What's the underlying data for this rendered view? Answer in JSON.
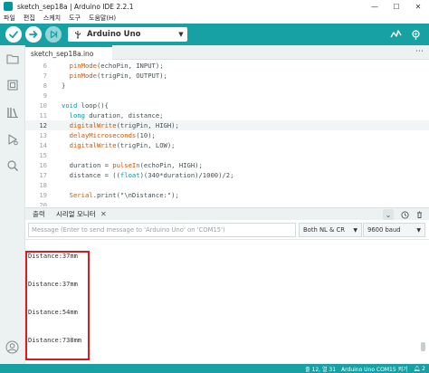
{
  "window": {
    "title": "sketch_sep18a | Arduino IDE 2.2.1",
    "controls": [
      "—",
      "☐",
      "✕"
    ]
  },
  "menu": [
    "파일",
    "편집",
    "스케치",
    "도구",
    "도움말(H)"
  ],
  "toolbar": {
    "board_name": "Arduino Uno",
    "board_arrow": "▼"
  },
  "tabs": [
    {
      "label": "sketch_sep18a.ino"
    }
  ],
  "tab_more": "⋯",
  "editor": {
    "active_line": "12",
    "lines": [
      {
        "n": "6",
        "pre": "  ",
        "kw": "pinMode",
        "post": "(echoPin, INPUT);"
      },
      {
        "n": "7",
        "pre": "  ",
        "kw": "pinMode",
        "post": "(trigPin, OUTPUT);"
      },
      {
        "n": "8",
        "pre": "",
        "kw": "",
        "post": "}"
      },
      {
        "n": "9",
        "pre": "",
        "kw": "",
        "post": ""
      },
      {
        "n": "10",
        "pre": "",
        "kw": "void",
        "post": " loop(){"
      },
      {
        "n": "11",
        "pre": "  ",
        "kw": "long",
        "post": " duration, distance;"
      },
      {
        "n": "12",
        "pre": "  ",
        "kw": "digitalWrite",
        "post": "(trigPin, HIGH);"
      },
      {
        "n": "13",
        "pre": "  ",
        "kw": "delayMicroseconds",
        "post": "(10);"
      },
      {
        "n": "14",
        "pre": "  ",
        "kw": "digitalWrite",
        "post": "(trigPin, LOW);"
      },
      {
        "n": "15",
        "pre": "",
        "kw": "",
        "post": ""
      },
      {
        "n": "16",
        "pre": "  duration = ",
        "kw": "pulseIn",
        "post": "(echoPin, HIGH);"
      },
      {
        "n": "17",
        "pre": "  distance = ((",
        "kw": "float",
        "post": ")(340*duration)/1000)/2;"
      },
      {
        "n": "18",
        "pre": "",
        "kw": "",
        "post": ""
      },
      {
        "n": "19",
        "pre": "  ",
        "kw": "Serial",
        "post": ".print(\"\\nDistance:\");"
      },
      {
        "n": "20",
        "pre": "",
        "kw": "",
        "post": ""
      }
    ]
  },
  "panel": {
    "tab_output": "출력",
    "tab_serial": "시리얼 모니터",
    "close": "✕",
    "chevron": "⌄"
  },
  "serial": {
    "placeholder": "Message (Enter to send message to 'Arduino Uno' on 'COM15')",
    "line_ending": "Both NL & CR",
    "baud": "9600 baud",
    "arrow": "▼",
    "output": [
      "Distance:37mm",
      "Distance:37mm",
      "Distance:54mm",
      "Distance:738mm"
    ]
  },
  "status": {
    "position": "줄 12, 열 31",
    "board": "Arduino Uno COM15 켜기",
    "notifications": "2"
  },
  "colors": {
    "accent": "#17a1a5",
    "keyword_orange": "#d35400",
    "keyword_teal": "#00979d",
    "highlight_box": "#e0191e"
  }
}
